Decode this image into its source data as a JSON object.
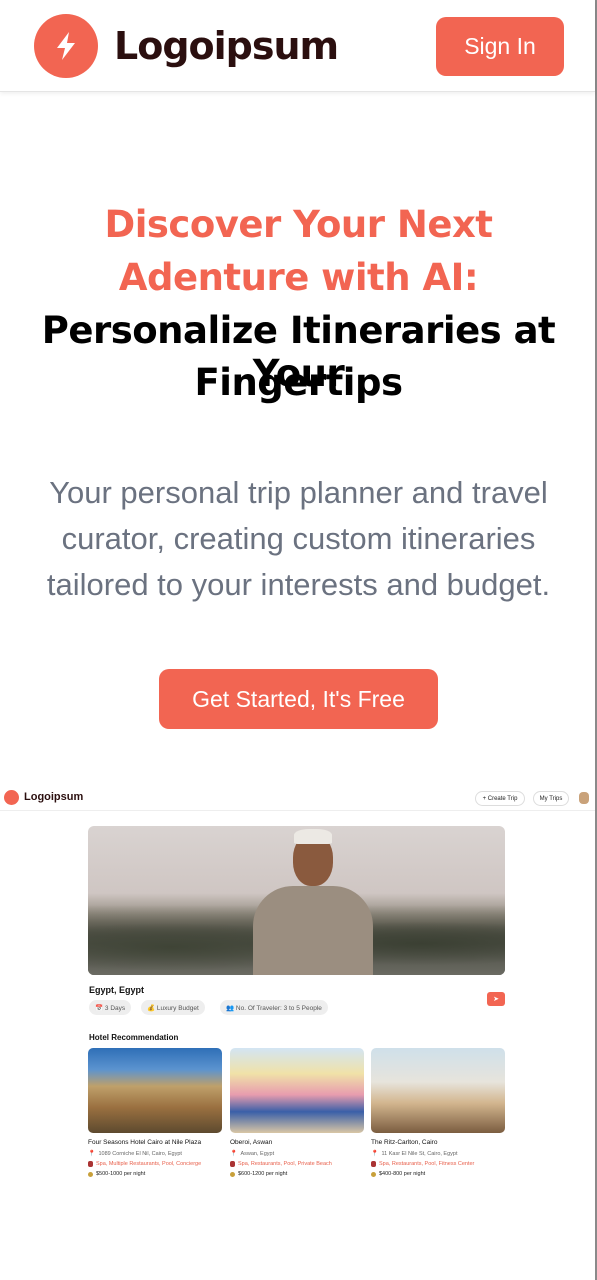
{
  "header": {
    "logo_text": "Logoipsum",
    "signin_label": "Sign In"
  },
  "hero": {
    "accent_line1": "Discover Your Next",
    "accent_line2": "Adenture with AI:",
    "dark_line1": "Personalize Itineraries at Your",
    "dark_line2": "Fingertips",
    "subtitle_line1": "Your personal trip planner and travel",
    "subtitle_line2": "curator, creating custom itineraries",
    "subtitle_line3": "tailored to your interests and budget.",
    "cta_label": "Get Started, It's Free"
  },
  "preview": {
    "logo_text": "Logoipsum",
    "create_trip_label": "+ Create Trip",
    "my_trips_label": "My Trips",
    "trip_title": "Egypt, Egypt",
    "chips": [
      "📅 3 Days",
      "💰 Luxury Budget",
      "👥 No. Of Traveler: 3 to 5 People"
    ],
    "section_title": "Hotel Recommendation",
    "hotels": [
      {
        "name": "Four Seasons Hotel Cairo at Nile Plaza",
        "address": "1089 Corniche El Nil, Cairo, Egypt",
        "amenities": "Spa,  Multiple Restaurants,  Pool,  Concierge",
        "price": "$500-1000 per night"
      },
      {
        "name": "Oberoi, Aswan",
        "address": "Aswan, Egypt",
        "amenities": "Spa,  Restaurants,  Pool,  Private Beach",
        "price": "$600-1200 per night"
      },
      {
        "name": "The Ritz-Carlton, Cairo",
        "address": "11 Kasr El Nile St, Cairo, Egypt",
        "amenities": "Spa,  Restaurants,  Pool,  Fitness Center",
        "price": "$400-800 per night"
      }
    ]
  },
  "colors": {
    "accent": "#f26552",
    "logo_text": "#2b0f0f",
    "subtitle": "#6b7280"
  }
}
